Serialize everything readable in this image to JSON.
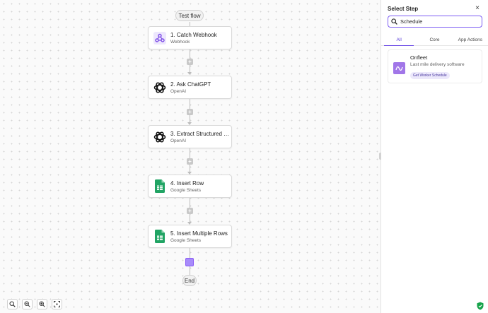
{
  "canvas": {
    "test_flow_label": "Test flow",
    "end_label": "End",
    "nodes": [
      {
        "title": "1. Catch Webhook",
        "subtitle": "Webhook",
        "icon": "webhook-icon"
      },
      {
        "title": "2. Ask ChatGPT",
        "subtitle": "OpenAI",
        "icon": "openai-icon"
      },
      {
        "title": "3. Extract Structured D...",
        "subtitle": "OpenAI",
        "icon": "openai-icon"
      },
      {
        "title": "4. Insert Row",
        "subtitle": "Google Sheets",
        "icon": "google-sheets-icon"
      },
      {
        "title": "5. Insert Multiple Rows",
        "subtitle": "Google Sheets",
        "icon": "google-sheets-icon"
      }
    ],
    "zoom_controls": [
      "zoom-fit-icon",
      "zoom-out-icon",
      "zoom-in-icon",
      "focus-icon"
    ]
  },
  "panel": {
    "title": "Select Step",
    "close_glyph": "×",
    "search": {
      "value": "Schedule",
      "placeholder": "Search"
    },
    "tabs": [
      {
        "label": "All",
        "active": true
      },
      {
        "label": "Core",
        "active": false
      },
      {
        "label": "App Actions",
        "active": false
      }
    ],
    "result": {
      "name": "Onfleet",
      "description": "Last mile delivery software",
      "action": "Get Worker Schedule"
    }
  },
  "colors": {
    "accent": "#7c5cf3",
    "sheets_green": "#21a464",
    "onfleet_purple": "#a176e8",
    "webhook_purple": "#8b5cf6"
  }
}
